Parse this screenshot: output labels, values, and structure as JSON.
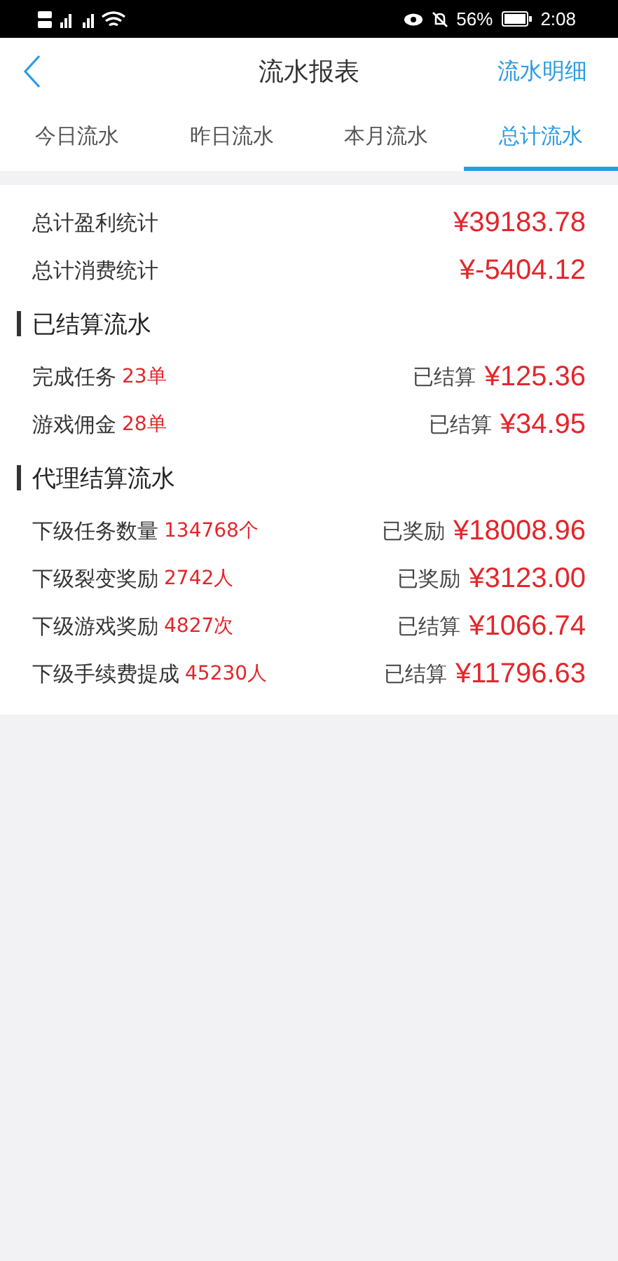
{
  "status_bar": {
    "battery": "56%",
    "time": "2:08"
  },
  "header": {
    "title": "流水报表",
    "action": "流水明细"
  },
  "tabs": [
    {
      "label": "今日流水",
      "selected": false
    },
    {
      "label": "昨日流水",
      "selected": false
    },
    {
      "label": "本月流水",
      "selected": false
    },
    {
      "label": "总计流水",
      "selected": true
    }
  ],
  "summary": [
    {
      "label": "总计盈利统计",
      "amount": "¥39183.78"
    },
    {
      "label": "总计消费统计",
      "amount": "¥-5404.12"
    }
  ],
  "sections": [
    {
      "title": "已结算流水",
      "rows": [
        {
          "label": "完成任务",
          "count": "23单",
          "status": "已结算",
          "amount": "¥125.36"
        },
        {
          "label": "游戏佣金",
          "count": "28单",
          "status": "已结算",
          "amount": "¥34.95"
        }
      ]
    },
    {
      "title": "代理结算流水",
      "rows": [
        {
          "label": "下级任务数量",
          "count": "134768个",
          "status": "已奖励",
          "amount": "¥18008.96"
        },
        {
          "label": "下级裂变奖励",
          "count": "2742人",
          "status": "已奖励",
          "amount": "¥3123.00"
        },
        {
          "label": "下级游戏奖励",
          "count": "4827次",
          "status": "已结算",
          "amount": "¥1066.74"
        },
        {
          "label": "下级手续费提成",
          "count": "45230人",
          "status": "已结算",
          "amount": "¥11796.63"
        }
      ]
    }
  ]
}
